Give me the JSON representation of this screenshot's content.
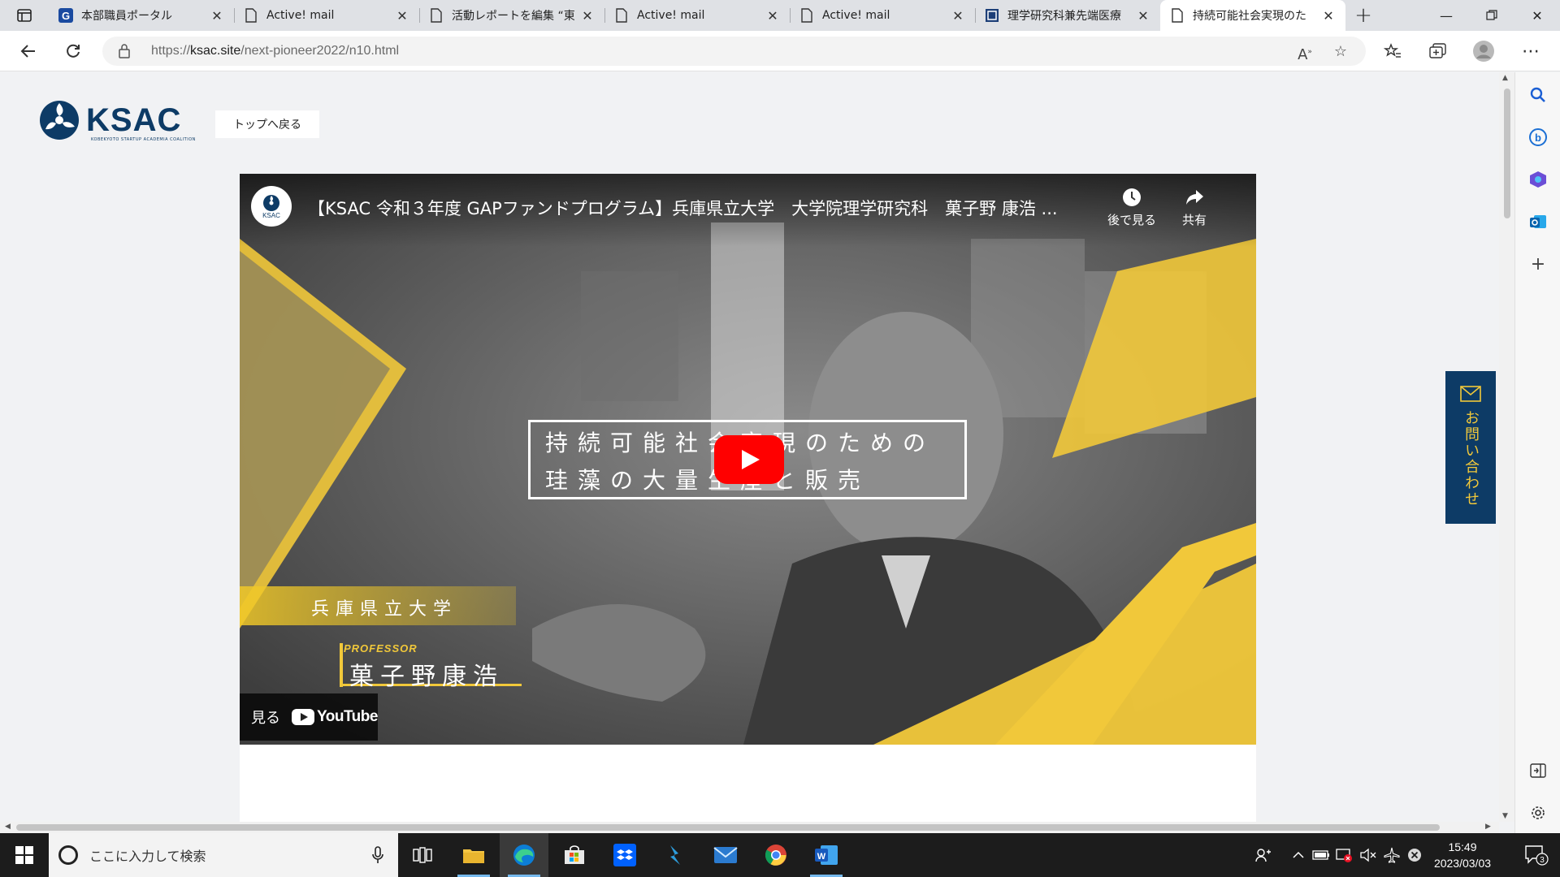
{
  "browser": {
    "tabs": [
      {
        "label": "本部職員ポータル",
        "icon": "g-letter-icon",
        "active": false
      },
      {
        "label": "Active! mail",
        "icon": "page-icon",
        "active": false
      },
      {
        "label": "活動レポートを編集 “東京",
        "icon": "page-icon",
        "active": false
      },
      {
        "label": "Active! mail",
        "icon": "page-icon",
        "active": false
      },
      {
        "label": "Active! mail",
        "icon": "page-icon",
        "active": false
      },
      {
        "label": "理学研究科兼先端医療",
        "icon": "site-icon",
        "active": false
      },
      {
        "label": "持続可能社会実現のた",
        "icon": "page-icon",
        "active": true
      }
    ],
    "url_prefix": "https://",
    "url_host": "ksac.site",
    "url_path": "/next-pioneer2022/n10.html"
  },
  "page": {
    "logo_text": "KSAC",
    "logo_subtext": "KOBEKYOTO STARTUP ACADEMIA COALITION",
    "back_button": "トップへ戻る",
    "contact_label": "お問い合わせ",
    "accent_navy": "#0d3b66",
    "accent_yellow": "#f1c83a"
  },
  "video": {
    "channel_badge": "KSAC",
    "title": "【KSAC 令和３年度 GAPファンドプログラム】兵庫県立大学　大学院理学研究科　菓子野 康浩 ...",
    "watch_later": "後で見る",
    "share": "共有",
    "card_line1": "持続可能社会実現のための",
    "card_line2": "珪藻の大量生産と販売",
    "university": "兵庫県立大学",
    "professor_label": "PROFESSOR",
    "professor_name": "菓子野康浩",
    "watch_on": "見る",
    "youtube": "YouTube"
  },
  "taskbar": {
    "search_placeholder": "ここに入力して検索",
    "time": "15:49",
    "date": "2023/03/03",
    "notification_count": "3"
  }
}
